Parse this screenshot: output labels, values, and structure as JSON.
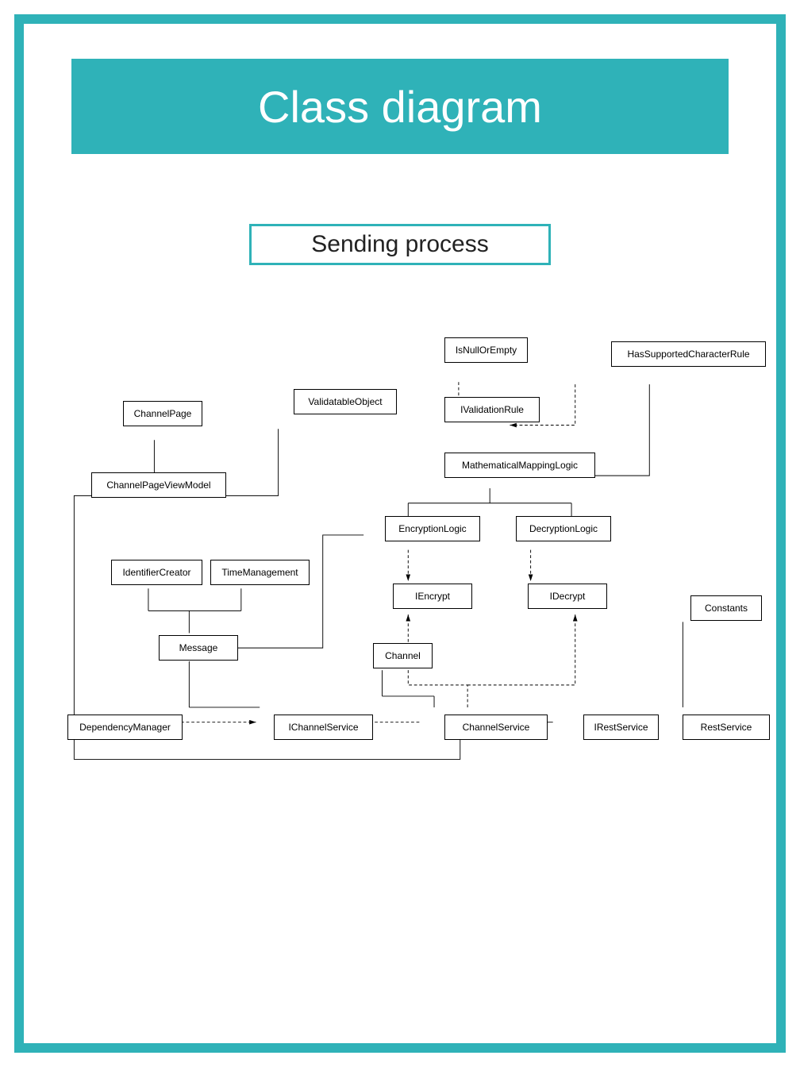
{
  "title": "Class diagram",
  "subtitle": "Sending process",
  "boxes": {
    "isNullOrEmpty": "IsNullOrEmpty",
    "hasSupportedCharacterRule": "HasSupportedCharacterRule",
    "validatableObject": "ValidatableObject",
    "iValidationRule": "IValidationRule",
    "channelPage": "ChannelPage",
    "mathematicalMappingLogic": "MathematicalMappingLogic",
    "channelPageViewModel": "ChannelPageViewModel",
    "encryptionLogic": "EncryptionLogic",
    "decryptionLogic": "DecryptionLogic",
    "identifierCreator": "IdentifierCreator",
    "timeManagement": "TimeManagement",
    "iEncrypt": "IEncrypt",
    "iDecrypt": "IDecrypt",
    "constants": "Constants",
    "message": "Message",
    "channel": "Channel",
    "dependencyManager": "DependencyManager",
    "iChannelService": "IChannelService",
    "channelService": "ChannelService",
    "iRestService": "IRestService",
    "restService": "RestService"
  }
}
